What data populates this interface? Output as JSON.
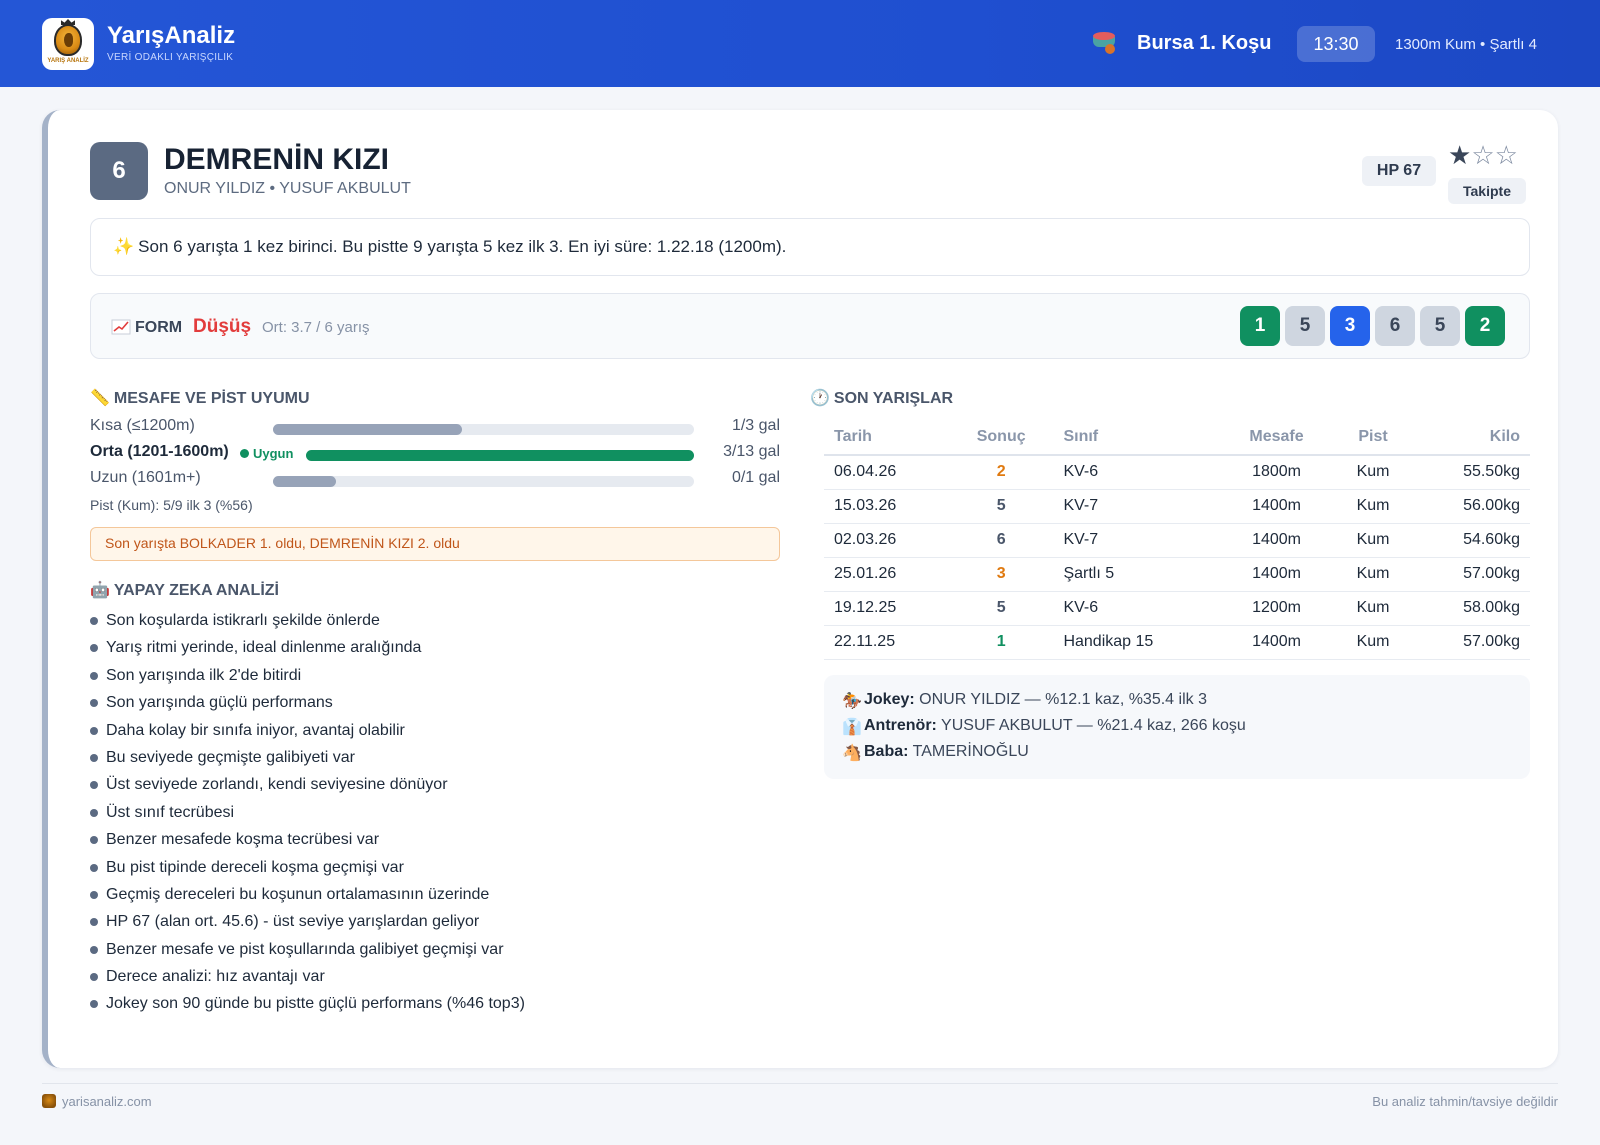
{
  "header": {
    "logo_text": "YARIŞ ANALİZ",
    "brand": "YarışAnaliz",
    "tagline": "VERİ ODAKLI YARIŞÇILIK",
    "race_title": "Bursa 1. Koşu",
    "time": "13:30",
    "race_meta": "1300m Kum • Şartlı 4"
  },
  "horse": {
    "number": "6",
    "name": "DEMRENİN KIZI",
    "subtitle": "ONUR YILDIZ • YUSUF AKBULUT",
    "hp": "HP 67",
    "rating": 1,
    "rating_max": 3,
    "follow_label": "Takipte"
  },
  "summary": {
    "icon": "sparkles-icon",
    "text": "Son 6 yarışta 1 kez birinci. Bu pistte 9 yarışta 5 kez ilk 3. En iyi süre: 1.22.18 (1200m)."
  },
  "form": {
    "icon": "chart-up-icon",
    "label": "FORM",
    "trend": "Düşüş",
    "average": "Ort: 3.7 / 6 yarış",
    "results": [
      "1",
      "5",
      "3",
      "6",
      "5",
      "2"
    ]
  },
  "distance": {
    "title": "MESAFE VE PİST UYUMU",
    "icon": "ruler-icon",
    "rows": [
      {
        "label": "Kısa (≤1200m)",
        "value": "1/3 gal",
        "fraction": 0.45,
        "highlight": false
      },
      {
        "label": "Orta (1201-1600m)",
        "badge": "Uygun",
        "value": "3/13 gal",
        "fraction": 1.0,
        "highlight": true
      },
      {
        "label": "Uzun (1601m+)",
        "value": "0/1 gal",
        "fraction": 0.15,
        "highlight": false
      }
    ],
    "pist": "Pist (Kum): 5/9 ilk 3 (%56)",
    "note": "Son yarışta BOLKADER 1. oldu, DEMRENİN KIZI 2. oldu"
  },
  "ai": {
    "title": "YAPAY ZEKA ANALİZİ",
    "icon": "robot-icon",
    "items": [
      "Son koşularda istikrarlı şekilde önlerde",
      "Yarış ritmi yerinde, ideal dinlenme aralığında",
      "Son yarışında ilk 2'de bitirdi",
      "Son yarışında güçlü performans",
      "Daha kolay bir sınıfa iniyor, avantaj olabilir",
      "Bu seviyede geçmişte galibiyeti var",
      "Üst seviyede zorlandı, kendi seviyesine dönüyor",
      "Üst sınıf tecrübesi",
      "Benzer mesafede koşma tecrübesi var",
      "Bu pist tipinde dereceli koşma geçmişi var",
      "Geçmiş dereceleri bu koşunun ortalamasının üzerinde",
      "HP 67 (alan ort. 45.6) - üst seviye yarışlardan geliyor",
      "Benzer mesafe ve pist koşullarında galibiyet geçmişi var",
      "Derece analizi: hız avantajı var",
      "Jokey son 90 günde bu pistte güçlü performans (%46 top3)"
    ]
  },
  "races": {
    "title": "SON YARIŞLAR",
    "icon": "clock-icon",
    "columns": [
      "Tarih",
      "Sonuç",
      "Sınıf",
      "Mesafe",
      "Pist",
      "Kilo"
    ],
    "rows": [
      {
        "date": "06.04.26",
        "result": "2",
        "class": "KV-6",
        "distance": "1800m",
        "track": "Kum",
        "weight": "55.50kg",
        "result_color": "#e07a10"
      },
      {
        "date": "15.03.26",
        "result": "5",
        "class": "KV-7",
        "distance": "1400m",
        "track": "Kum",
        "weight": "56.00kg",
        "result_color": "#4a566a"
      },
      {
        "date": "02.03.26",
        "result": "6",
        "class": "KV-7",
        "distance": "1400m",
        "track": "Kum",
        "weight": "54.60kg",
        "result_color": "#4a566a"
      },
      {
        "date": "25.01.26",
        "result": "3",
        "class": "Şartlı 5",
        "distance": "1400m",
        "track": "Kum",
        "weight": "57.00kg",
        "result_color": "#e07a10"
      },
      {
        "date": "19.12.25",
        "result": "5",
        "class": "KV-6",
        "distance": "1200m",
        "track": "Kum",
        "weight": "58.00kg",
        "result_color": "#4a566a"
      },
      {
        "date": "22.11.25",
        "result": "1",
        "class": "Handikap 15",
        "distance": "1400m",
        "track": "Kum",
        "weight": "57.00kg",
        "result_color": "#109060"
      }
    ]
  },
  "people": {
    "jockey_label": "Jokey:",
    "jockey": "ONUR YILDIZ — %12.1 kaz, %35.4 ilk 3",
    "trainer_label": "Antrenör:",
    "trainer": "YUSUF AKBULUT — %21.4 kaz, 266 koşu",
    "sire_label": "Baba:",
    "sire": "TAMERİNOĞLU"
  },
  "footer": {
    "site": "yarisanaliz.com",
    "disclaimer": "Bu analiz tahmin/tavsiye değildir"
  },
  "colors": {
    "header_blue": "#2456d6",
    "green": "#109060",
    "blue": "#2563eb",
    "red": "#e23c3c",
    "orange": "#e07a10",
    "bar_gray": "#97a3b8"
  }
}
